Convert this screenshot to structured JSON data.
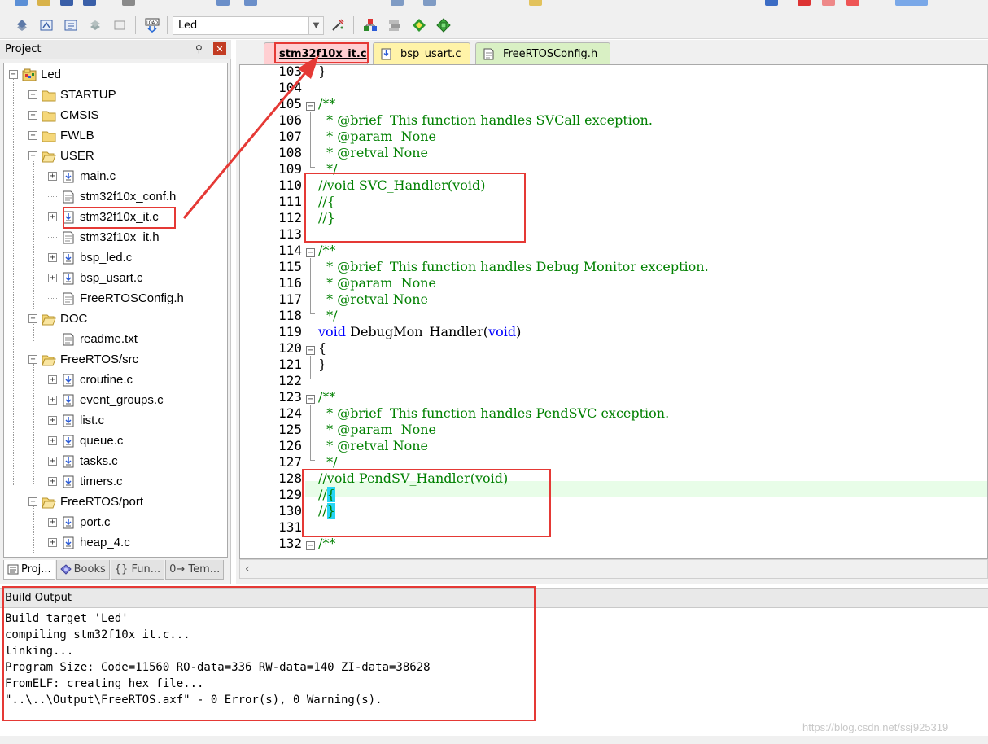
{
  "toolbar": {
    "target_name": "Led"
  },
  "project_panel": {
    "title": "Project",
    "tree": [
      {
        "label": "Led",
        "kind": "root",
        "level": 0
      },
      {
        "label": "STARTUP",
        "kind": "folder",
        "level": 1
      },
      {
        "label": "CMSIS",
        "kind": "folder",
        "level": 1
      },
      {
        "label": "FWLB",
        "kind": "folder",
        "level": 1
      },
      {
        "label": "USER",
        "kind": "folder-open",
        "level": 1
      },
      {
        "label": "main.c",
        "kind": "c-file",
        "level": 2
      },
      {
        "label": "stm32f10x_conf.h",
        "kind": "h-file",
        "level": 2
      },
      {
        "label": "stm32f10x_it.c",
        "kind": "c-file",
        "level": 2
      },
      {
        "label": "stm32f10x_it.h",
        "kind": "h-file",
        "level": 2
      },
      {
        "label": "bsp_led.c",
        "kind": "c-file",
        "level": 2
      },
      {
        "label": "bsp_usart.c",
        "kind": "c-file",
        "level": 2
      },
      {
        "label": "FreeRTOSConfig.h",
        "kind": "h-file",
        "level": 2
      },
      {
        "label": "DOC",
        "kind": "folder-open",
        "level": 1
      },
      {
        "label": "readme.txt",
        "kind": "txt-file",
        "level": 2
      },
      {
        "label": "FreeRTOS/src",
        "kind": "folder-open",
        "level": 1
      },
      {
        "label": "croutine.c",
        "kind": "c-file",
        "level": 2
      },
      {
        "label": "event_groups.c",
        "kind": "c-file",
        "level": 2
      },
      {
        "label": "list.c",
        "kind": "c-file",
        "level": 2
      },
      {
        "label": "queue.c",
        "kind": "c-file",
        "level": 2
      },
      {
        "label": "tasks.c",
        "kind": "c-file",
        "level": 2
      },
      {
        "label": "timers.c",
        "kind": "c-file",
        "level": 2
      },
      {
        "label": "FreeRTOS/port",
        "kind": "folder-open",
        "level": 1
      },
      {
        "label": "port.c",
        "kind": "c-file",
        "level": 2
      },
      {
        "label": "heap_4.c",
        "kind": "c-file",
        "level": 2
      }
    ],
    "tabs": [
      "Proj...",
      "Books",
      "{} Fun...",
      "0→ Tem..."
    ]
  },
  "editor": {
    "tabs": [
      {
        "label": "stm32f10x_it.c",
        "active": true
      },
      {
        "label": "bsp_usart.c",
        "active": false
      },
      {
        "label": "FreeRTOSConfig.h",
        "active": false
      }
    ],
    "lines": [
      {
        "n": "103",
        "text": "}"
      },
      {
        "n": "104",
        "text": ""
      },
      {
        "n": "105",
        "text": "/**"
      },
      {
        "n": "106",
        "text": "  * @brief  This function handles SVCall exception."
      },
      {
        "n": "107",
        "text": "  * @param  None"
      },
      {
        "n": "108",
        "text": "  * @retval None"
      },
      {
        "n": "109",
        "text": "  */"
      },
      {
        "n": "110",
        "text": "//void SVC_Handler(void)"
      },
      {
        "n": "111",
        "text": "//{"
      },
      {
        "n": "112",
        "text": "//}"
      },
      {
        "n": "113",
        "text": ""
      },
      {
        "n": "114",
        "text": "/**"
      },
      {
        "n": "115",
        "text": "  * @brief  This function handles Debug Monitor exception."
      },
      {
        "n": "116",
        "text": "  * @param  None"
      },
      {
        "n": "117",
        "text": "  * @retval None"
      },
      {
        "n": "118",
        "text": "  */"
      },
      {
        "n": "119",
        "text": "void DebugMon_Handler(void)"
      },
      {
        "n": "120",
        "text": "{"
      },
      {
        "n": "121",
        "text": "}"
      },
      {
        "n": "122",
        "text": ""
      },
      {
        "n": "123",
        "text": "/**"
      },
      {
        "n": "124",
        "text": "  * @brief  This function handles PendSVC exception."
      },
      {
        "n": "125",
        "text": "  * @param  None"
      },
      {
        "n": "126",
        "text": "  * @retval None"
      },
      {
        "n": "127",
        "text": "  */"
      },
      {
        "n": "128",
        "text": "//void PendSV_Handler(void)"
      },
      {
        "n": "129",
        "text": "//{"
      },
      {
        "n": "130",
        "text": "//}"
      },
      {
        "n": "131",
        "text": ""
      },
      {
        "n": "132",
        "text": "/**"
      }
    ]
  },
  "build_output": {
    "title": "Build Output",
    "lines": [
      "Build target 'Led'",
      "compiling stm32f10x_it.c...",
      "linking...",
      "Program Size: Code=11560 RO-data=336 RW-data=140 ZI-data=38628",
      "FromELF: creating hex file...",
      "\"..\\..\\Output\\FreeRTOS.axf\" - 0 Error(s), 0 Warning(s)."
    ]
  },
  "watermark": "https://blog.csdn.net/ssj925319",
  "colors": {
    "comment": "#008000",
    "keyword": "#0000ff",
    "annotation_red": "#e53935",
    "active_tab": "#ffcfd2",
    "inactive_tab_yellow": "#fff3a8",
    "inactive_tab_green": "#d9f0c4",
    "current_line": "#e8fde8",
    "brace_match": "#25d5f5"
  }
}
